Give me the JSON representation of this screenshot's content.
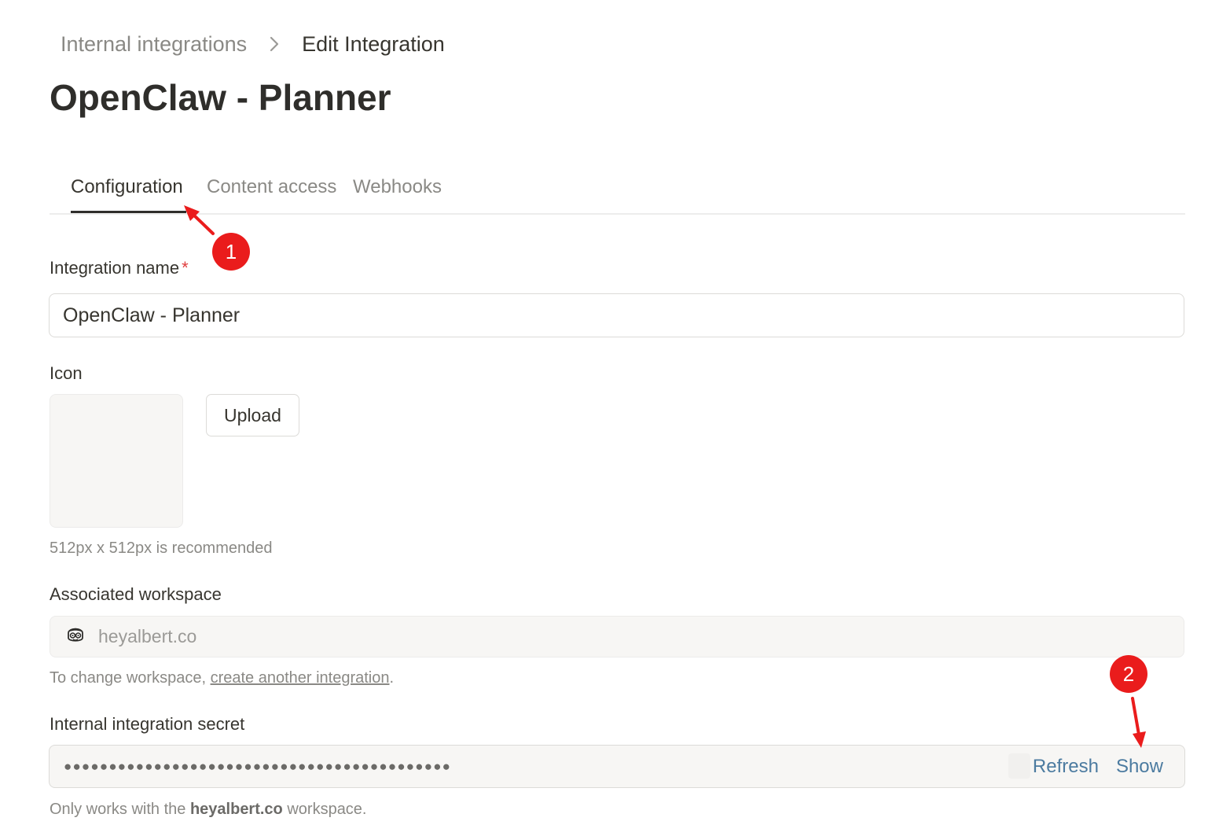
{
  "breadcrumb": {
    "parent": "Internal integrations",
    "current": "Edit Integration"
  },
  "page_title": "OpenClaw - Planner",
  "tabs": [
    {
      "label": "Configuration",
      "active": true
    },
    {
      "label": "Content access",
      "active": false
    },
    {
      "label": "Webhooks",
      "active": false
    }
  ],
  "integration_name": {
    "label": "Integration name",
    "required_mark": "*",
    "value": "OpenClaw - Planner"
  },
  "icon": {
    "label": "Icon",
    "upload_button": "Upload",
    "hint": "512px x 512px is recommended"
  },
  "workspace": {
    "label": "Associated workspace",
    "name": "heyalbert.co",
    "hint_prefix": "To change workspace, ",
    "hint_link": "create another integration",
    "hint_suffix": "."
  },
  "secret": {
    "label": "Internal integration secret",
    "masked_value": "●●●●●●●●●●●●●●●●●●●●●●●●●●●●●●●●●●●●●●●●●●●",
    "refresh_label": "Refresh",
    "show_label": "Show",
    "hint_prefix": "Only works with the ",
    "hint_bold": "heyalbert.co",
    "hint_suffix": " workspace."
  },
  "annotations": {
    "marker_1": "1",
    "marker_2": "2",
    "color": "#ea1c1c"
  },
  "icons": {
    "breadcrumb_separator": "chevron-right-icon",
    "workspace_avatar": "avatar-face-icon"
  }
}
